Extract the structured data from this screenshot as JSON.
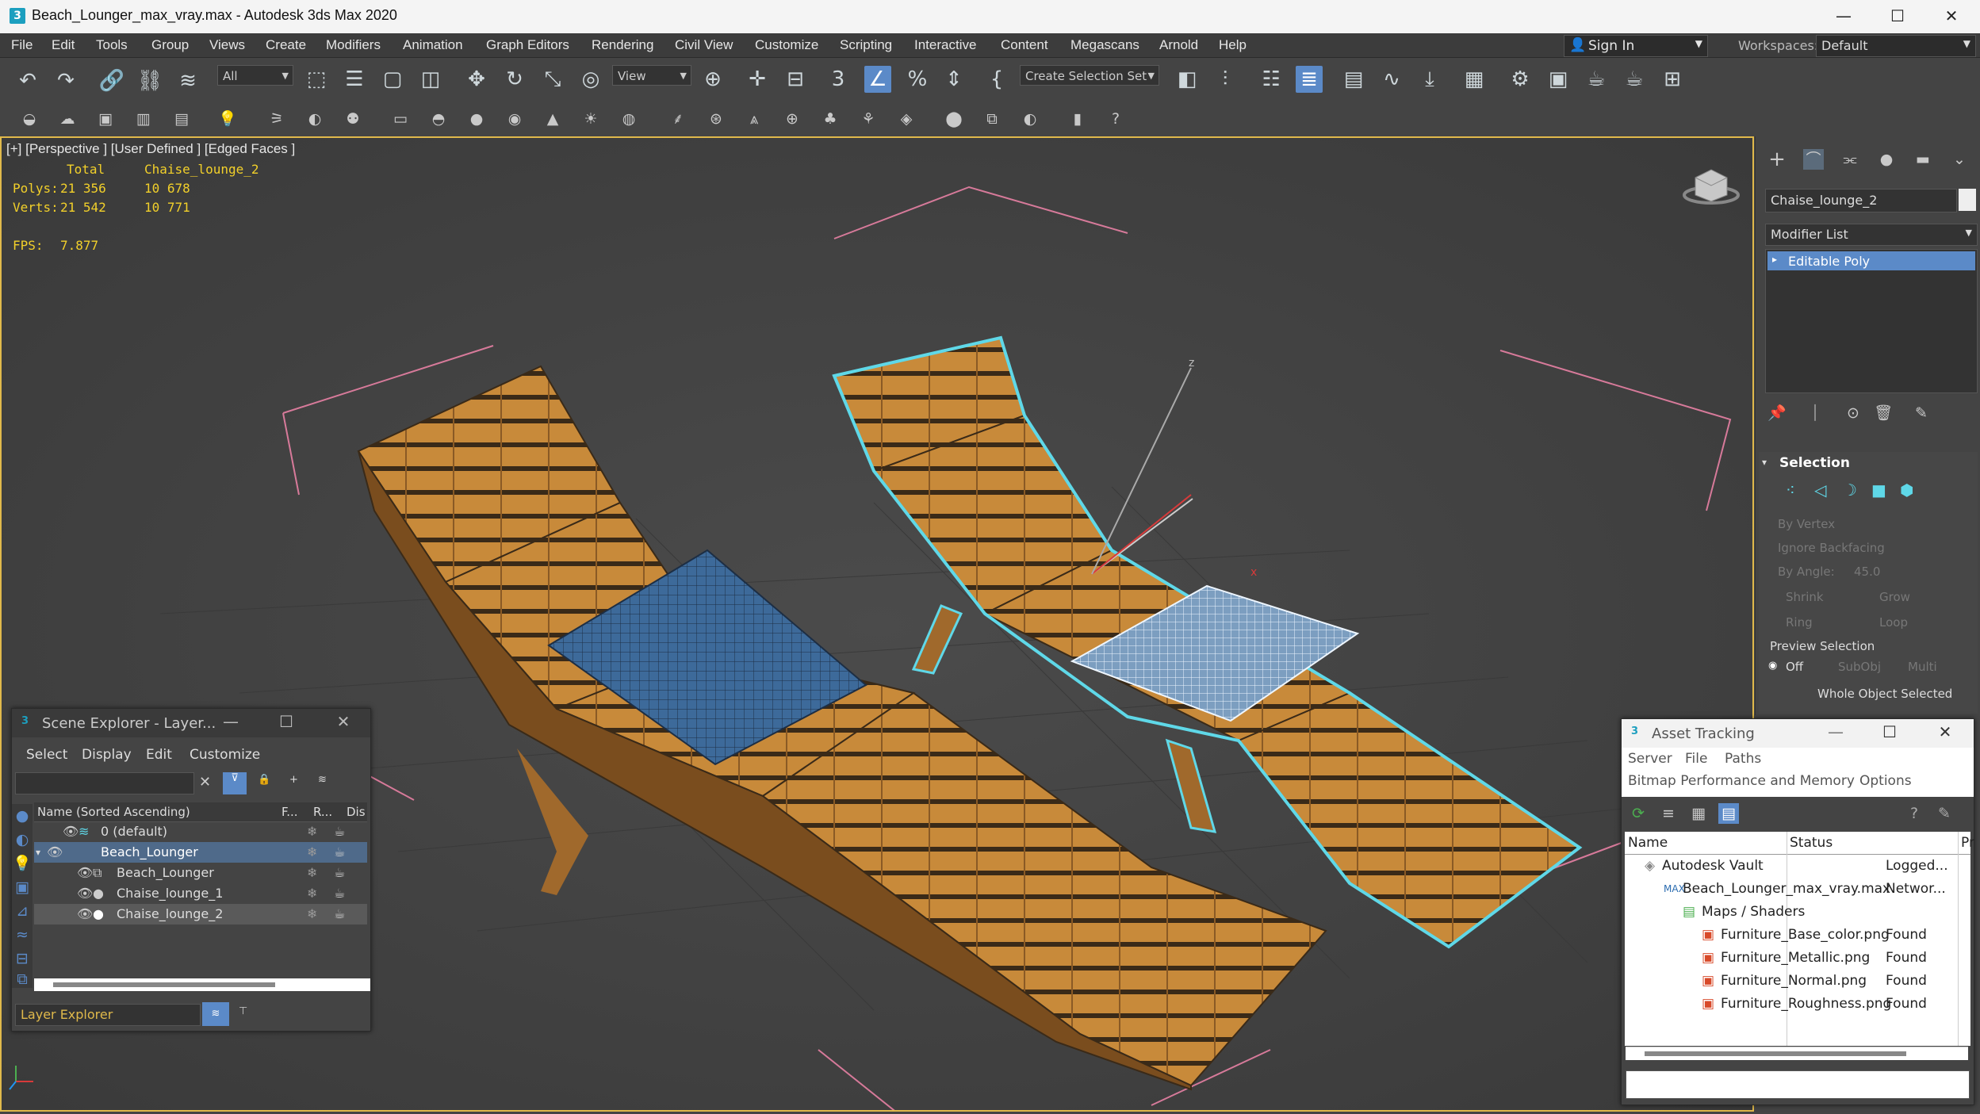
{
  "window": {
    "app_icon": "3",
    "title": "Beach_Lounger_max_vray.max - Autodesk 3ds Max 2020",
    "minimize": "—",
    "maximize": "☐",
    "close": "✕"
  },
  "menu": [
    "File",
    "Edit",
    "Tools",
    "Group",
    "Views",
    "Create",
    "Modifiers",
    "Animation",
    "Graph Editors",
    "Rendering",
    "Civil View",
    "Customize",
    "Scripting",
    "Interactive",
    "Content",
    "Megascans",
    "Arnold",
    "Help"
  ],
  "signin": {
    "label": "Sign In"
  },
  "workspaces": {
    "label": "Workspaces:",
    "value": "Default"
  },
  "toolbar": {
    "selection_filter": "All",
    "reference_coord": "View",
    "selection_set": "Create Selection Set"
  },
  "viewport": {
    "label": "[+] [Perspective ] [User Defined ] [Edged Faces ]",
    "stats": {
      "header_total": "Total",
      "header_object": "Chaise_lounge_2",
      "polys_label": "Polys:",
      "polys_total": "21 356",
      "polys_object": "10 678",
      "verts_label": "Verts:",
      "verts_total": "21 542",
      "verts_object": "10 771",
      "fps_label": "FPS:",
      "fps_value": "7.877"
    }
  },
  "command_panel": {
    "object_name": "Chaise_lounge_2",
    "modifier_list": "Modifier List",
    "modifier_stack": [
      "Editable Poly"
    ],
    "selection_title": "Selection",
    "by_vertex": "By Vertex",
    "ignore_backfacing": "Ignore Backfacing",
    "by_angle": "By Angle:",
    "angle_value": "45.0",
    "shrink": "Shrink",
    "grow": "Grow",
    "ring": "Ring",
    "loop": "Loop",
    "preview_selection": "Preview Selection",
    "off": "Off",
    "subobj": "SubObj",
    "multi": "Multi",
    "status": "Whole Object Selected"
  },
  "scene_explorer": {
    "title": "Scene Explorer - Layer...",
    "menu": [
      "Select",
      "Display",
      "Edit",
      "Customize"
    ],
    "columns": {
      "name": "Name (Sorted Ascending)",
      "f": "F...",
      "r": "R...",
      "dis": "Dis"
    },
    "rows": [
      {
        "name": "0 (default)",
        "indent": 0
      },
      {
        "name": "Beach_Lounger",
        "indent": 0
      },
      {
        "name": "Beach_Lounger",
        "indent": 1
      },
      {
        "name": "Chaise_lounge_1",
        "indent": 1
      },
      {
        "name": "Chaise_lounge_2",
        "indent": 1
      }
    ],
    "footer_label": "Layer Explorer"
  },
  "asset_tracking": {
    "title": "Asset Tracking",
    "menu": [
      "Server",
      "File",
      "Paths"
    ],
    "menu2": [
      "Bitmap Performance and Memory",
      "Options"
    ],
    "columns": {
      "name": "Name",
      "status": "Status",
      "pr": "Pr"
    },
    "rows": [
      {
        "name": "Autodesk Vault",
        "status": "Logged...",
        "indent": 0
      },
      {
        "name": "Beach_Lounger_max_vray.max",
        "status": "Networ...",
        "indent": 1
      },
      {
        "name": "Maps / Shaders",
        "status": "",
        "indent": 2
      },
      {
        "name": "Furniture_Base_color.png",
        "status": "Found",
        "indent": 3
      },
      {
        "name": "Furniture_Metallic.png",
        "status": "Found",
        "indent": 3
      },
      {
        "name": "Furniture_Normal.png",
        "status": "Found",
        "indent": 3
      },
      {
        "name": "Furniture_Roughness.png",
        "status": "Found",
        "indent": 3
      }
    ]
  },
  "colors": {
    "viewport_border": "#e0b94b",
    "selection_outline": "#5fd8e8",
    "wood": "#c88a3a",
    "pillow": "#3d6a9a",
    "stat_text": "#f2d02a"
  }
}
